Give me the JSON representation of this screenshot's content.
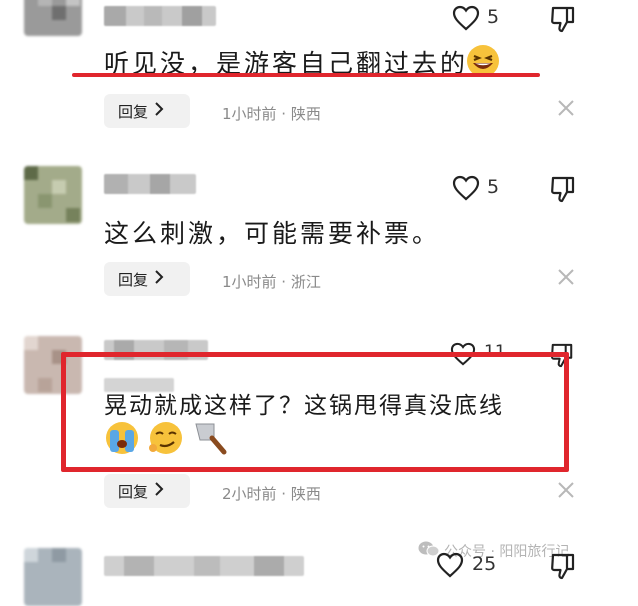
{
  "comments": [
    {
      "text": "听见没，是游客自己翻过去的",
      "likes": "5",
      "reply_label": "回复",
      "meta": "1小时前 · 陕西"
    },
    {
      "text": "这么刺激，可能需要补票。",
      "likes": "5",
      "reply_label": "回复",
      "meta": "1小时前 · 浙江"
    },
    {
      "text": "晃动就成这样了？这锅甩得真没底线",
      "likes": "11",
      "reply_label": "回复",
      "meta": "2小时前 · 陕西"
    },
    {
      "likes": "25"
    }
  ],
  "watermark": {
    "text": "公众号 · 阳阳旅行记",
    "icon": "wechat-icon"
  },
  "icons": {
    "like": "heart-outline-icon",
    "dislike": "thumbs-down-icon",
    "reply_chevron": "chevron-right-icon",
    "close": "close-icon"
  },
  "colors": {
    "highlight_red": "#e0262d",
    "meta_gray": "#8a8a8a",
    "reply_bg": "#f1f1f1"
  }
}
